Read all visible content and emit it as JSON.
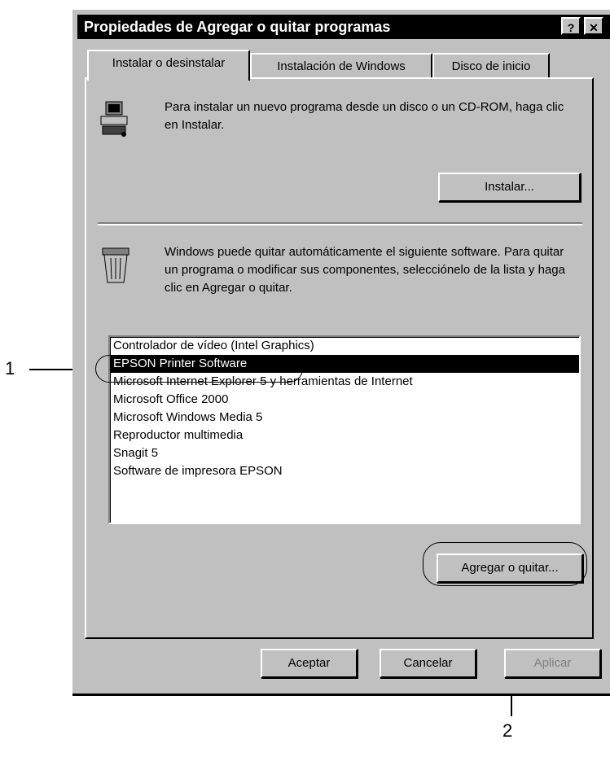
{
  "dialog": {
    "title": "Propiedades de Agregar o quitar programas",
    "help_glyph": "?",
    "close_glyph": "✕"
  },
  "tabs": [
    {
      "label": "Instalar o desinstalar"
    },
    {
      "label": "Instalación de Windows"
    },
    {
      "label": "Disco de inicio"
    }
  ],
  "install_section": {
    "description": "Para instalar un nuevo programa desde un disco o un CD-ROM, haga clic en Instalar.",
    "install_button": "Instalar..."
  },
  "uninstall_section": {
    "description": "Windows puede quitar automáticamente el siguiente software. Para quitar un programa o modificar sus componentes, selecciónelo de la lista y haga clic en Agregar o quitar."
  },
  "program_list": [
    "Controlador de vídeo (Intel Graphics)",
    "EPSON Printer Software",
    "Microsoft Internet Explorer 5 y herramientas de Internet",
    "Microsoft Office 2000",
    "Microsoft Windows Media 5",
    "Reproductor multimedia",
    "Snagit 5",
    "Software de impresora EPSON"
  ],
  "add_remove_button": "Agregar o quitar...",
  "footer": {
    "accept_button": "Aceptar",
    "cancel_button": "Cancelar",
    "apply_button": "Aplicar"
  },
  "callouts": {
    "one": "1",
    "two": "2"
  }
}
